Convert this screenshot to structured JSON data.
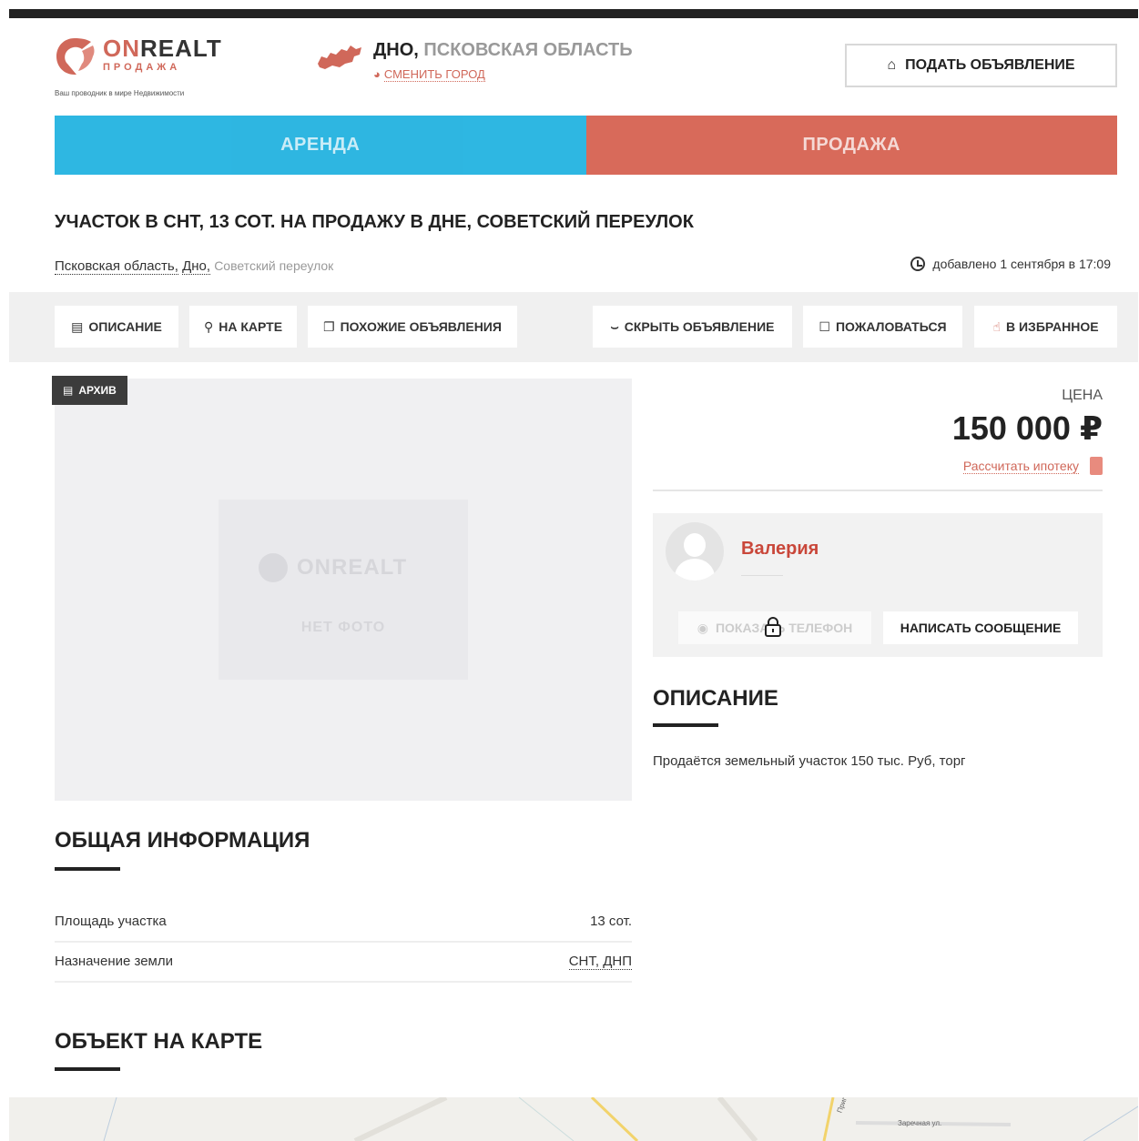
{
  "header": {
    "logo_name_on": "ON",
    "logo_name_rest": "REALT",
    "logo_sub": "ПРОДАЖА",
    "logo_tag": "Ваш проводник в мире Недвижимости",
    "city": "ДНО,",
    "region": "ПСКОВСКАЯ ОБЛАСТЬ",
    "change_city": "СМЕНИТЬ ГОРОД",
    "post_button": "ПОДАТЬ ОБЪЯВЛЕНИЕ"
  },
  "tabs": [
    {
      "label": "АРЕНДА"
    },
    {
      "label": "ПРОДАЖА"
    }
  ],
  "listing": {
    "title": "УЧАСТОК В СНТ, 13 СОТ. НА ПРОДАЖУ В ДНЕ, СОВЕТСКИЙ ПЕРЕУЛОК",
    "address_region": "Псковская область,",
    "address_city": "Дно,",
    "address_street": "Советский переулок",
    "added": "добавлено 1 сентября в 17:09"
  },
  "actions": {
    "description": "ОПИСАНИЕ",
    "map": "НА КАРТЕ",
    "similar": "ПОХОЖИЕ ОБЪЯВЛЕНИЯ",
    "hide": "СКРЫТЬ ОБЪЯВЛЕНИЕ",
    "report": "ПОЖАЛОВАТЬСЯ",
    "favorite": "В ИЗБРАННОЕ"
  },
  "photo": {
    "archive_badge": "АРХИВ",
    "placeholder_logo": "ONREALT",
    "no_photo": "НЕТ ФОТО"
  },
  "price": {
    "label": "ЦЕНА",
    "value": "150 000 ₽",
    "mortgage_link": "Рассчитать ипотеку"
  },
  "seller": {
    "name": "Валерия",
    "show_phone": "ПОКАЗАТЬ ТЕЛЕФОН",
    "write_message": "НАПИСАТЬ СООБЩЕНИЕ"
  },
  "description": {
    "heading": "ОПИСАНИЕ",
    "text": "Продаётся земельный участок 150 тыс. Руб, торг"
  },
  "general_info": {
    "heading": "ОБЩАЯ ИНФОРМАЦИЯ",
    "rows": [
      {
        "key": "Площадь участка",
        "value": "13 сот."
      },
      {
        "key": "Назначение земли",
        "value": "СНТ, ДНП"
      }
    ]
  },
  "map_section": {
    "heading": "ОБЪЕКТ НА КАРТЕ",
    "labels": [
      "Приг",
      "Заречная ул."
    ]
  },
  "colors": {
    "brand": "#d0685a",
    "rent_tab": "#23b3e0",
    "sale_tab": "#d86a5a",
    "seller_name": "#c9473a"
  }
}
